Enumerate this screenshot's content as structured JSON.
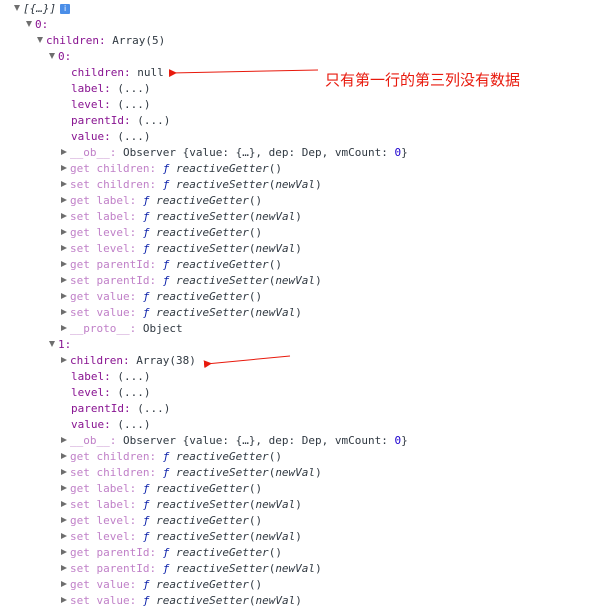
{
  "console": {
    "root_summary": "[{…}]",
    "root_info_icon": "i",
    "item0_key": "0:",
    "item0_children_label": "children:",
    "item0_children_value": "Array(5)",
    "c0_key": "0:",
    "c0_props": [
      {
        "key": "children:",
        "value": "null"
      },
      {
        "key": "label:",
        "value": "(...)"
      },
      {
        "key": "level:",
        "value": "(...)"
      },
      {
        "key": "parentId:",
        "value": "(...)"
      },
      {
        "key": "value:",
        "value": "(...)"
      }
    ],
    "c1_key": "1:",
    "c1_children_key": "children:",
    "c1_children_value": "Array(38)",
    "c1_props": [
      {
        "key": "label:",
        "value": "(...)"
      },
      {
        "key": "level:",
        "value": "(...)"
      },
      {
        "key": "parentId:",
        "value": "(...)"
      },
      {
        "key": "value:",
        "value": "(...)"
      }
    ],
    "ob": {
      "key": "__ob__:",
      "text_before": "Observer {value: {…}, dep: Dep, vmCount: ",
      "count": "0",
      "text_after": "}"
    },
    "accessors": [
      {
        "key": "get children:",
        "fn": "reactiveGetter",
        "param": ""
      },
      {
        "key": "set children:",
        "fn": "reactiveSetter",
        "param": "newVal"
      },
      {
        "key": "get label:",
        "fn": "reactiveGetter",
        "param": ""
      },
      {
        "key": "set label:",
        "fn": "reactiveSetter",
        "param": "newVal"
      },
      {
        "key": "get level:",
        "fn": "reactiveGetter",
        "param": ""
      },
      {
        "key": "set level:",
        "fn": "reactiveSetter",
        "param": "newVal"
      },
      {
        "key": "get parentId:",
        "fn": "reactiveGetter",
        "param": ""
      },
      {
        "key": "set parentId:",
        "fn": "reactiveSetter",
        "param": "newVal"
      },
      {
        "key": "get value:",
        "fn": "reactiveGetter",
        "param": ""
      },
      {
        "key": "set value:",
        "fn": "reactiveSetter",
        "param": "newVal"
      }
    ],
    "f_symbol": "ƒ",
    "proto": {
      "key": "__proto__:",
      "value": "Object"
    }
  },
  "annotation": {
    "note_text": "只有第一行的第三列没有数据",
    "color": "#e8190c"
  }
}
